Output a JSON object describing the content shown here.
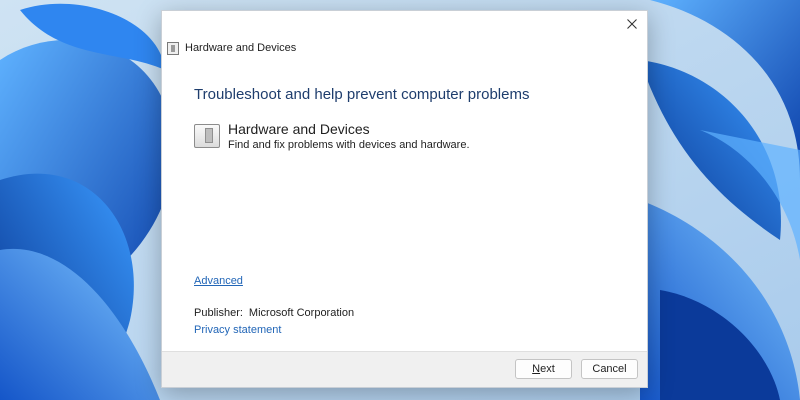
{
  "window": {
    "title": "Hardware and Devices",
    "icon": "troubleshooter-icon",
    "close_icon": "close-icon"
  },
  "main": {
    "heading": "Troubleshoot and help prevent computer problems",
    "item": {
      "icon": "hardware-device-icon",
      "title": "Hardware and Devices",
      "description": "Find and fix problems with devices and hardware."
    },
    "advanced_link": "Advanced",
    "publisher_label": "Publisher:",
    "publisher_value": "Microsoft Corporation",
    "privacy_link": "Privacy statement"
  },
  "footer": {
    "next_first": "N",
    "next_rest": "ext",
    "cancel_label": "Cancel"
  },
  "colors": {
    "heading": "#1e3d6d",
    "link": "#2266b7",
    "wallpaper": "#1f6fd6"
  }
}
